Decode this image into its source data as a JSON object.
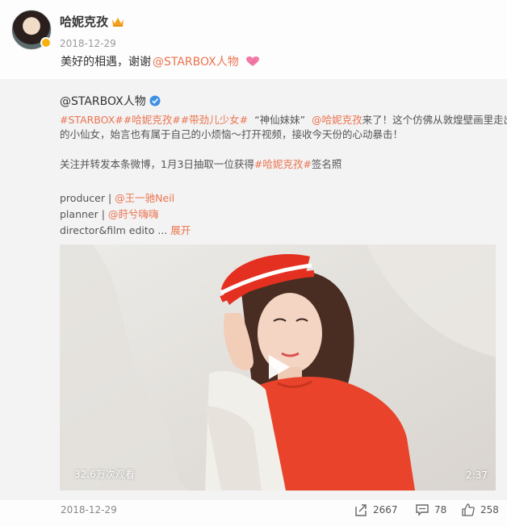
{
  "post": {
    "username": "哈妮克孜",
    "date": "2018-12-29",
    "text_prefix": "美好的相遇，谢谢",
    "mention": "@STARBOX人物"
  },
  "repost": {
    "author": "@STARBOX人物",
    "line1": {
      "tag1": "#STARBOX#",
      "tag2": "#哈妮克孜#",
      "tag3": "#带劲儿少女#",
      "quote": "“神仙妹妹”",
      "mention": "@哈妮克孜",
      "text": "来了！这个仿佛从敦煌壁画里走出来"
    },
    "line2": "的小仙女，始言也有属于自己的小烦恼～打开视频，接收今天份的心动暴击！",
    "line3": {
      "text_prefix": "关注并转发本条微博，1月3日抽取一位获得",
      "tag": "#哈妮克孜#",
      "text_suffix": "签名照"
    },
    "credits": {
      "producer_label": "producer | ",
      "producer_name": "@王一驰Neil",
      "planner_label": "planner | ",
      "planner_name": "@莳兮嗨嗨",
      "director_label": "director&film edito ...",
      "expand": "展开"
    },
    "video": {
      "views": "32.6万次观看",
      "duration": "2:37"
    }
  },
  "footer": {
    "date": "2018-12-29",
    "reposts": "2667",
    "comments": "78",
    "likes": "258"
  },
  "colors": {
    "accent": "#eb7350",
    "verified": "#f6b10f",
    "repost_bg": "#f3f3f3"
  },
  "icons": [
    "crown-icon",
    "heart-icon",
    "verified-icon",
    "play-icon",
    "share-icon",
    "comment-icon",
    "like-icon"
  ]
}
